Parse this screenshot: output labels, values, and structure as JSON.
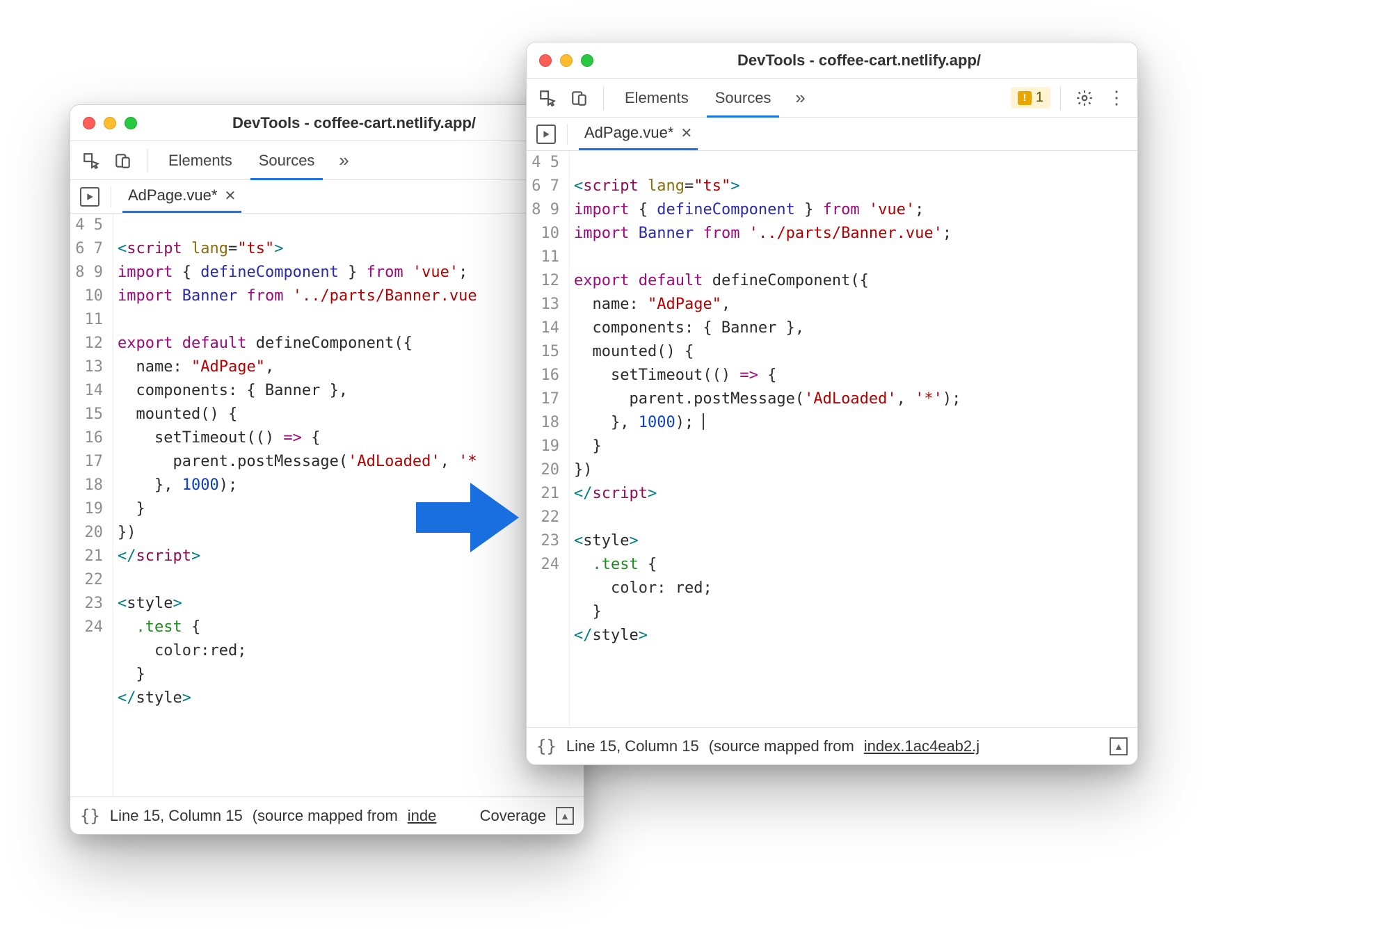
{
  "left": {
    "title": "DevTools - coffee-cart.netlify.app/",
    "tabs": [
      "Elements",
      "Sources"
    ],
    "activeTab": "Sources",
    "fileTab": "AdPage.vue*",
    "statusLineCol": "Line 15, Column 15",
    "statusMapped": "(source mapped from",
    "statusMappedLink": "inde",
    "statusCoverage": "Coverage",
    "lines": [
      4,
      5,
      6,
      7,
      8,
      9,
      10,
      11,
      12,
      13,
      14,
      15,
      16,
      17,
      18,
      19,
      20,
      21,
      22,
      23,
      24
    ]
  },
  "right": {
    "title": "DevTools - coffee-cart.netlify.app/",
    "tabs": [
      "Elements",
      "Sources"
    ],
    "activeTab": "Sources",
    "fileTab": "AdPage.vue*",
    "warningCount": "1",
    "statusLineCol": "Line 15, Column 15",
    "statusMapped": "(source mapped from",
    "statusMappedLink": "index.1ac4eab2.j",
    "lines": [
      4,
      5,
      6,
      7,
      8,
      9,
      10,
      11,
      12,
      13,
      14,
      15,
      16,
      17,
      18,
      19,
      20,
      21,
      22,
      23,
      24
    ]
  },
  "strings": {
    "script_open_1": "<",
    "script_open_2": "script",
    "lang_attr": " lang",
    "eq": "=",
    "ts_val": "\"ts\"",
    "gt": ">",
    "import": "import",
    "defineComponent": "defineComponent",
    "from": "from",
    "vue": "'vue'",
    "semicolon": ";",
    "banner": "Banner",
    "banner_path": "'../parts/Banner.vue'",
    "banner_path_trunc": "'../parts/Banner.vue",
    "export": "export",
    "default": "default",
    "lbrace": "{",
    "rbrace": "}",
    "lparen": "(",
    "rparen": ")",
    "name_key": "name",
    "colon": ":",
    "adpage": "\"AdPage\"",
    "comma": ",",
    "components_key": "components",
    "mounted": "mounted",
    "setTimeout": "setTimeout",
    "arrow": "=>",
    "parent": "parent",
    "dot": ".",
    "postMessage": "postMessage",
    "adloaded": "'AdLoaded'",
    "star_trunc": "'*",
    "star_full": "'*'",
    "thousand": "1000",
    "script_close": "script",
    "style_open": "style",
    "test_class": ".test",
    "color_prop": "color",
    "red_val_nospace": "red",
    "red_val_space": " red"
  }
}
